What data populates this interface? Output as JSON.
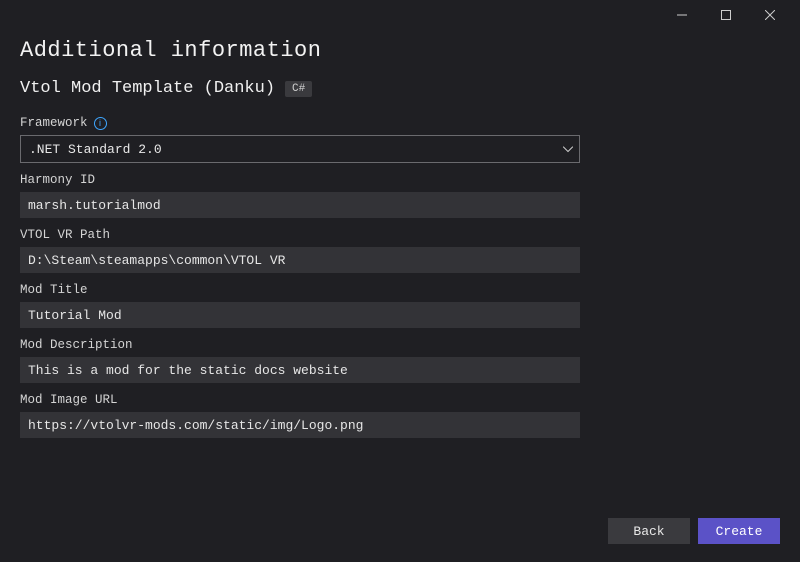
{
  "window": {
    "title": "Additional information"
  },
  "template": {
    "name": "Vtol Mod Template (Danku)",
    "language": "C#"
  },
  "fields": {
    "framework": {
      "label": "Framework",
      "value": ".NET Standard 2.0"
    },
    "harmonyId": {
      "label": "Harmony ID",
      "value": "marsh.tutorialmod"
    },
    "vrPath": {
      "label": "VTOL VR Path",
      "value": "D:\\Steam\\steamapps\\common\\VTOL VR"
    },
    "modTitle": {
      "label": "Mod Title",
      "value": "Tutorial Mod"
    },
    "modDescription": {
      "label": "Mod Description",
      "value": "This is a mod for the static docs website"
    },
    "modImageUrl": {
      "label": "Mod Image URL",
      "value": "https://vtolvr-mods.com/static/img/Logo.png"
    }
  },
  "buttons": {
    "back": "Back",
    "create": "Create"
  }
}
